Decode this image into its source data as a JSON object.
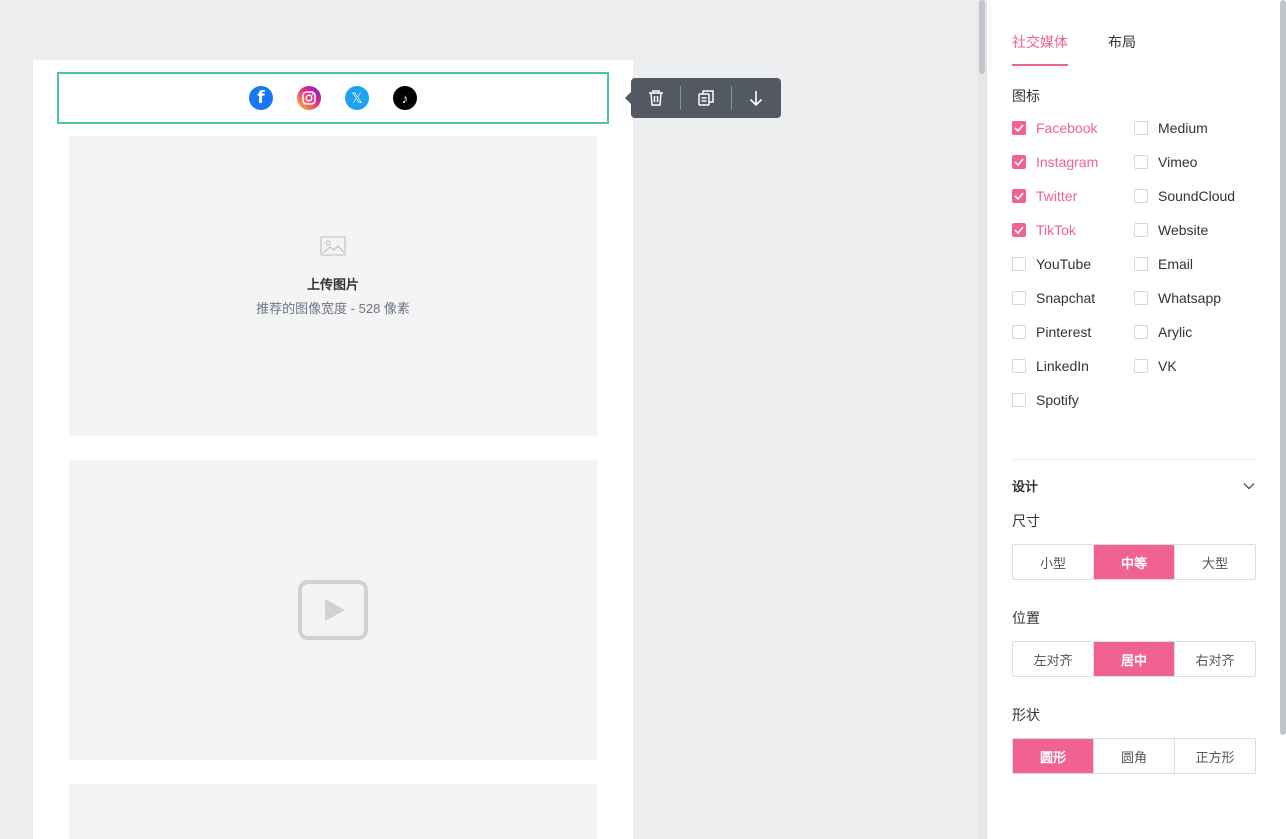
{
  "colors": {
    "accent": "#f06292",
    "selection": "#4fc3a1",
    "toolbar": "#535962"
  },
  "social_icons": [
    {
      "name": "facebook-icon",
      "glyph": "f"
    },
    {
      "name": "instagram-icon",
      "glyph": ""
    },
    {
      "name": "twitter-x-icon",
      "glyph": "𝕏"
    },
    {
      "name": "tiktok-icon",
      "glyph": "♪"
    }
  ],
  "toolbar": {
    "delete": "trash-icon",
    "duplicate": "copy-icon",
    "move_down": "arrow-down-icon"
  },
  "image_placeholder": {
    "title": "上传图片",
    "hint": "推荐的图像宽度 - 528 像素"
  },
  "panel": {
    "tabs": [
      {
        "label": "社交媒体",
        "active": true
      },
      {
        "label": "布局",
        "active": false
      }
    ],
    "icons_label": "图标",
    "platforms": [
      {
        "label": "Facebook",
        "checked": true
      },
      {
        "label": "Medium",
        "checked": false
      },
      {
        "label": "Instagram",
        "checked": true
      },
      {
        "label": "Vimeo",
        "checked": false
      },
      {
        "label": "Twitter",
        "checked": true
      },
      {
        "label": "SoundCloud",
        "checked": false
      },
      {
        "label": "TikTok",
        "checked": true
      },
      {
        "label": "Website",
        "checked": false
      },
      {
        "label": "YouTube",
        "checked": false
      },
      {
        "label": "Email",
        "checked": false
      },
      {
        "label": "Snapchat",
        "checked": false
      },
      {
        "label": "Whatsapp",
        "checked": false
      },
      {
        "label": "Pinterest",
        "checked": false
      },
      {
        "label": "Arylic",
        "checked": false
      },
      {
        "label": "LinkedIn",
        "checked": false
      },
      {
        "label": "VK",
        "checked": false
      },
      {
        "label": "Spotify",
        "checked": false
      }
    ],
    "design_label": "设计",
    "size": {
      "label": "尺寸",
      "options": [
        "小型",
        "中等",
        "大型"
      ],
      "selected": 1
    },
    "position": {
      "label": "位置",
      "options": [
        "左对齐",
        "居中",
        "右对齐"
      ],
      "selected": 1
    },
    "shape": {
      "label": "形状",
      "options": [
        "圆形",
        "圆角",
        "正方形"
      ],
      "selected": 0
    }
  }
}
